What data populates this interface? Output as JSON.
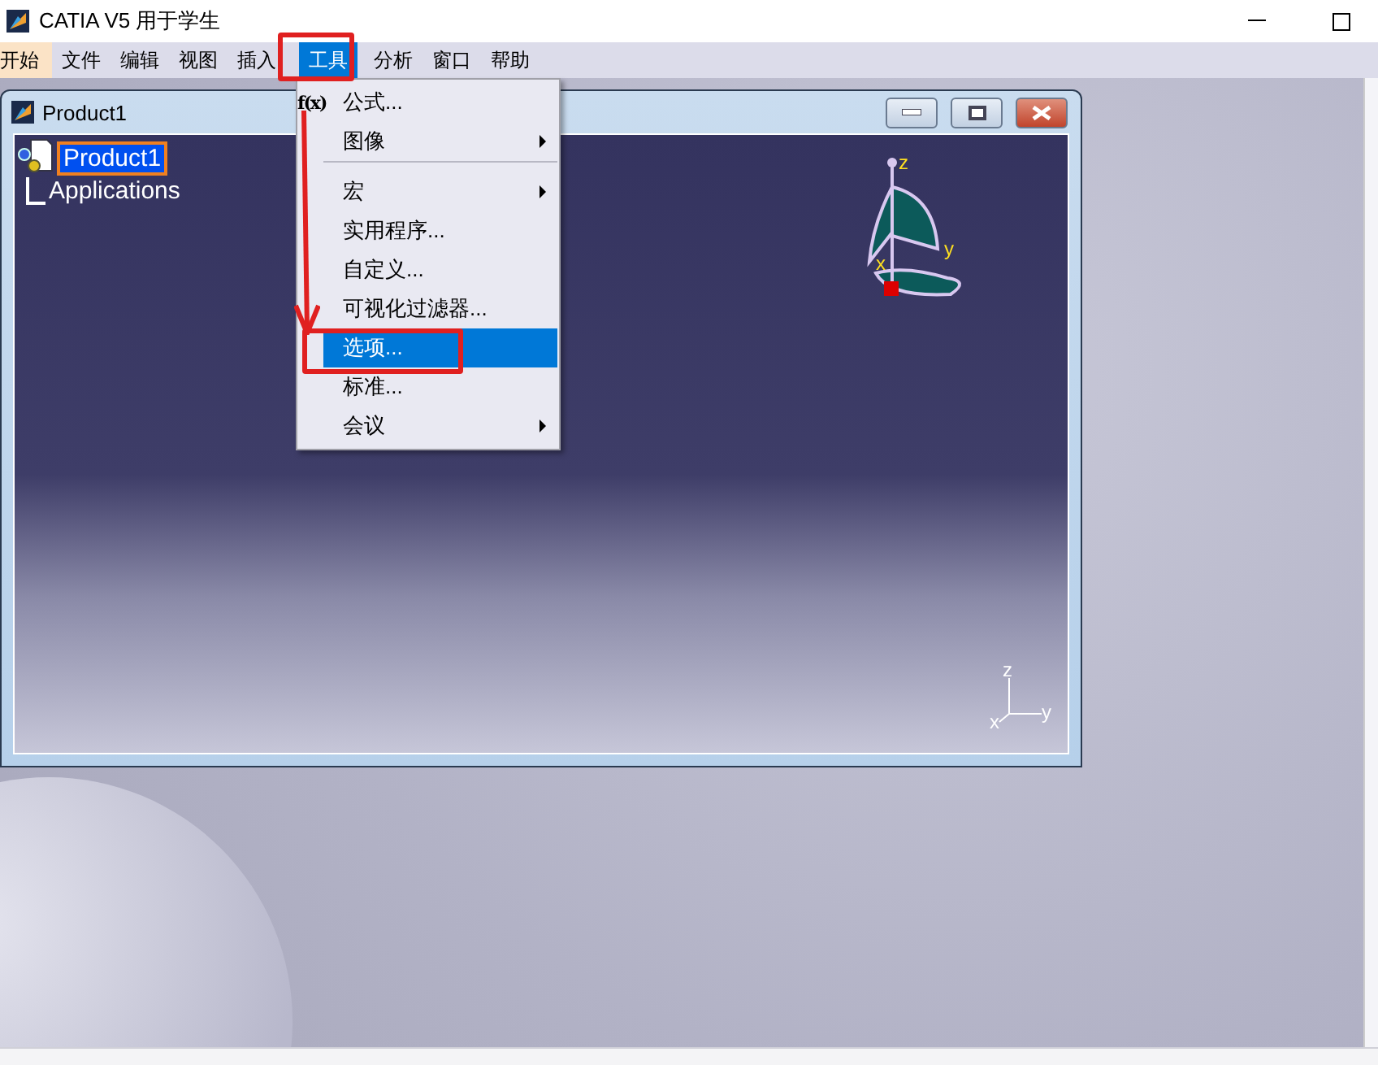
{
  "window": {
    "title": "CATIA V5 用于学生"
  },
  "menu_bar": [
    {
      "label": "开始",
      "selected": false,
      "kind": "workbench"
    },
    {
      "label": "文件",
      "selected": false,
      "kind": "menu"
    },
    {
      "label": "编辑",
      "selected": false,
      "kind": "menu"
    },
    {
      "label": "视图",
      "selected": false,
      "kind": "menu"
    },
    {
      "label": "插入",
      "selected": false,
      "kind": "menu"
    },
    {
      "label": "工具",
      "selected": true,
      "kind": "menu"
    },
    {
      "label": "分析",
      "selected": false,
      "kind": "menu"
    },
    {
      "label": "窗口",
      "selected": false,
      "kind": "menu"
    },
    {
      "label": "帮助",
      "selected": false,
      "kind": "menu"
    }
  ],
  "tools_menu": [
    {
      "label": "公式...",
      "icon": "f(x)",
      "submenu": false,
      "selected": false,
      "separator_after": false
    },
    {
      "label": "图像",
      "submenu": true,
      "selected": false,
      "separator_after": true
    },
    {
      "label": "宏",
      "submenu": true,
      "selected": false,
      "separator_after": false
    },
    {
      "label": "实用程序...",
      "submenu": false,
      "selected": false,
      "separator_after": false
    },
    {
      "label": "自定义...",
      "submenu": false,
      "selected": false,
      "separator_after": false
    },
    {
      "label": "可视化过滤器...",
      "submenu": false,
      "selected": false,
      "separator_after": false
    },
    {
      "label": "选项...",
      "submenu": false,
      "selected": true,
      "separator_after": false
    },
    {
      "label": "标准...",
      "submenu": false,
      "selected": false,
      "separator_after": false
    },
    {
      "label": "会议",
      "submenu": true,
      "selected": false,
      "separator_after": false
    }
  ],
  "document_window": {
    "title": "Product1",
    "tree": [
      {
        "label": "Product1",
        "selected": true,
        "children": [
          {
            "label": "Applications",
            "selected": false
          }
        ]
      }
    ],
    "compass": {
      "z": "z",
      "x": "x",
      "y": "y"
    },
    "axis_triad": {
      "z": "z",
      "x": "x",
      "y": "y"
    }
  }
}
